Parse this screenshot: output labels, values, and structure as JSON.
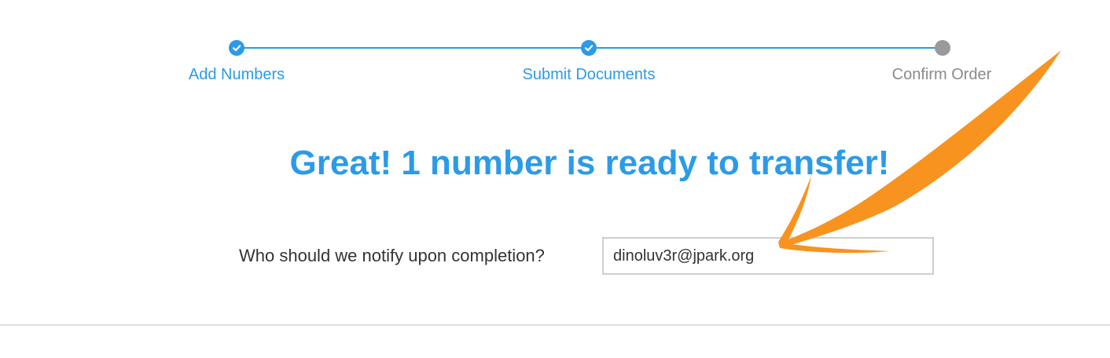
{
  "stepper": {
    "steps": [
      {
        "label": "Add Numbers",
        "status": "complete"
      },
      {
        "label": "Submit Documents",
        "status": "complete"
      },
      {
        "label": "Confirm Order",
        "status": "current"
      }
    ]
  },
  "main": {
    "headline": "Great! 1 number is ready to transfer!",
    "notify_label": "Who should we notify upon completion?",
    "notify_email": "dinoluv3r@jpark.org"
  },
  "colors": {
    "accent": "#2b9be8",
    "inactive": "#9a9a9a",
    "annotation": "#f7931e"
  },
  "icons": {
    "step_complete": "check-circle-icon",
    "step_current": "dot-icon",
    "annotation": "arrow-annotation-icon"
  }
}
